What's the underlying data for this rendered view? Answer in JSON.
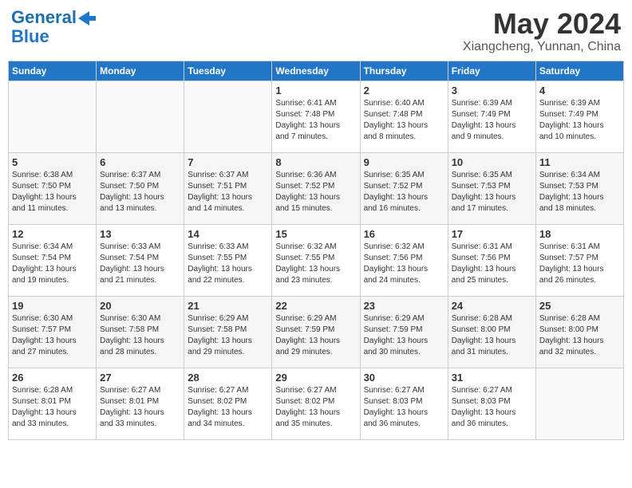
{
  "header": {
    "logo_line1": "General",
    "logo_line2": "Blue",
    "month_year": "May 2024",
    "location": "Xiangcheng, Yunnan, China"
  },
  "days_of_week": [
    "Sunday",
    "Monday",
    "Tuesday",
    "Wednesday",
    "Thursday",
    "Friday",
    "Saturday"
  ],
  "weeks": [
    [
      {
        "day": "",
        "text": ""
      },
      {
        "day": "",
        "text": ""
      },
      {
        "day": "",
        "text": ""
      },
      {
        "day": "1",
        "text": "Sunrise: 6:41 AM\nSunset: 7:48 PM\nDaylight: 13 hours\nand 7 minutes."
      },
      {
        "day": "2",
        "text": "Sunrise: 6:40 AM\nSunset: 7:48 PM\nDaylight: 13 hours\nand 8 minutes."
      },
      {
        "day": "3",
        "text": "Sunrise: 6:39 AM\nSunset: 7:49 PM\nDaylight: 13 hours\nand 9 minutes."
      },
      {
        "day": "4",
        "text": "Sunrise: 6:39 AM\nSunset: 7:49 PM\nDaylight: 13 hours\nand 10 minutes."
      }
    ],
    [
      {
        "day": "5",
        "text": "Sunrise: 6:38 AM\nSunset: 7:50 PM\nDaylight: 13 hours\nand 11 minutes."
      },
      {
        "day": "6",
        "text": "Sunrise: 6:37 AM\nSunset: 7:50 PM\nDaylight: 13 hours\nand 13 minutes."
      },
      {
        "day": "7",
        "text": "Sunrise: 6:37 AM\nSunset: 7:51 PM\nDaylight: 13 hours\nand 14 minutes."
      },
      {
        "day": "8",
        "text": "Sunrise: 6:36 AM\nSunset: 7:52 PM\nDaylight: 13 hours\nand 15 minutes."
      },
      {
        "day": "9",
        "text": "Sunrise: 6:35 AM\nSunset: 7:52 PM\nDaylight: 13 hours\nand 16 minutes."
      },
      {
        "day": "10",
        "text": "Sunrise: 6:35 AM\nSunset: 7:53 PM\nDaylight: 13 hours\nand 17 minutes."
      },
      {
        "day": "11",
        "text": "Sunrise: 6:34 AM\nSunset: 7:53 PM\nDaylight: 13 hours\nand 18 minutes."
      }
    ],
    [
      {
        "day": "12",
        "text": "Sunrise: 6:34 AM\nSunset: 7:54 PM\nDaylight: 13 hours\nand 19 minutes."
      },
      {
        "day": "13",
        "text": "Sunrise: 6:33 AM\nSunset: 7:54 PM\nDaylight: 13 hours\nand 21 minutes."
      },
      {
        "day": "14",
        "text": "Sunrise: 6:33 AM\nSunset: 7:55 PM\nDaylight: 13 hours\nand 22 minutes."
      },
      {
        "day": "15",
        "text": "Sunrise: 6:32 AM\nSunset: 7:55 PM\nDaylight: 13 hours\nand 23 minutes."
      },
      {
        "day": "16",
        "text": "Sunrise: 6:32 AM\nSunset: 7:56 PM\nDaylight: 13 hours\nand 24 minutes."
      },
      {
        "day": "17",
        "text": "Sunrise: 6:31 AM\nSunset: 7:56 PM\nDaylight: 13 hours\nand 25 minutes."
      },
      {
        "day": "18",
        "text": "Sunrise: 6:31 AM\nSunset: 7:57 PM\nDaylight: 13 hours\nand 26 minutes."
      }
    ],
    [
      {
        "day": "19",
        "text": "Sunrise: 6:30 AM\nSunset: 7:57 PM\nDaylight: 13 hours\nand 27 minutes."
      },
      {
        "day": "20",
        "text": "Sunrise: 6:30 AM\nSunset: 7:58 PM\nDaylight: 13 hours\nand 28 minutes."
      },
      {
        "day": "21",
        "text": "Sunrise: 6:29 AM\nSunset: 7:58 PM\nDaylight: 13 hours\nand 29 minutes."
      },
      {
        "day": "22",
        "text": "Sunrise: 6:29 AM\nSunset: 7:59 PM\nDaylight: 13 hours\nand 29 minutes."
      },
      {
        "day": "23",
        "text": "Sunrise: 6:29 AM\nSunset: 7:59 PM\nDaylight: 13 hours\nand 30 minutes."
      },
      {
        "day": "24",
        "text": "Sunrise: 6:28 AM\nSunset: 8:00 PM\nDaylight: 13 hours\nand 31 minutes."
      },
      {
        "day": "25",
        "text": "Sunrise: 6:28 AM\nSunset: 8:00 PM\nDaylight: 13 hours\nand 32 minutes."
      }
    ],
    [
      {
        "day": "26",
        "text": "Sunrise: 6:28 AM\nSunset: 8:01 PM\nDaylight: 13 hours\nand 33 minutes."
      },
      {
        "day": "27",
        "text": "Sunrise: 6:27 AM\nSunset: 8:01 PM\nDaylight: 13 hours\nand 33 minutes."
      },
      {
        "day": "28",
        "text": "Sunrise: 6:27 AM\nSunset: 8:02 PM\nDaylight: 13 hours\nand 34 minutes."
      },
      {
        "day": "29",
        "text": "Sunrise: 6:27 AM\nSunset: 8:02 PM\nDaylight: 13 hours\nand 35 minutes."
      },
      {
        "day": "30",
        "text": "Sunrise: 6:27 AM\nSunset: 8:03 PM\nDaylight: 13 hours\nand 36 minutes."
      },
      {
        "day": "31",
        "text": "Sunrise: 6:27 AM\nSunset: 8:03 PM\nDaylight: 13 hours\nand 36 minutes."
      },
      {
        "day": "",
        "text": ""
      }
    ]
  ]
}
